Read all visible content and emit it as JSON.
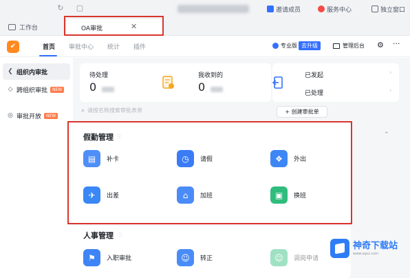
{
  "tabs": {
    "home_label": "工作台",
    "active_label": "OA审批"
  },
  "topbar": {
    "item1": "邀请成员",
    "item2": "服务中心",
    "item3": "独立窗口"
  },
  "nav": {
    "tabs": [
      "首页",
      "审批中心",
      "统计",
      "插件"
    ],
    "pro_label": "专业版",
    "upgrade_label": "去升级",
    "admin_label": "管理后台"
  },
  "sidebar": {
    "items": [
      {
        "label": "组织内审批"
      },
      {
        "label": "跨组织审批",
        "badge": "NEW"
      },
      {
        "label": "审批开放",
        "badge": "NEW"
      }
    ]
  },
  "stats": {
    "pending_label": "待处理",
    "pending_value": "0",
    "received_label": "我收到的",
    "received_value": "0",
    "sent_label": "已发起",
    "done_label": "已处理"
  },
  "search": {
    "placeholder": "请按名称搜索审批表单",
    "create_label": "+ 创建审批单"
  },
  "sections": [
    {
      "title": "假勤管理",
      "items": [
        "补卡",
        "请假",
        "外出",
        "出差",
        "加班",
        "换班"
      ]
    },
    {
      "title": "人事管理",
      "items": [
        "入职审批",
        "转正",
        "调岗申请"
      ]
    }
  ],
  "watermark": {
    "name": "神奇下载站",
    "url": "www.sqxz.com"
  },
  "colors": {
    "accent": "#3370ff",
    "highlight_box": "#d9342b",
    "logo_orange": "#ff8a1f"
  }
}
